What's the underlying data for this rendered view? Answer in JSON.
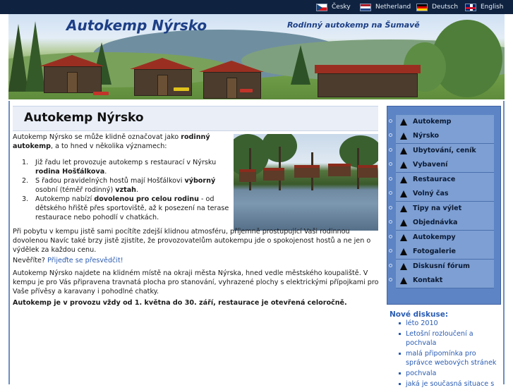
{
  "languages": [
    {
      "label": "Česky",
      "flag": "cz"
    },
    {
      "label": "Netherland",
      "flag": "nl"
    },
    {
      "label": "Deutsch",
      "flag": "de"
    },
    {
      "label": "English",
      "flag": "gb"
    }
  ],
  "banner": {
    "title": "Autokemp Nýrsko",
    "subtitle": "Rodinný autokemp na Šumavě"
  },
  "main": {
    "heading": "Autokemp Nýrsko",
    "intro_pre": "Autokemp Nýrsko se může klidně označovat jako ",
    "intro_bold": "rodinný autokemp",
    "intro_post": ", a to hned v několika významech:",
    "list": [
      {
        "num": "1.",
        "pre": "Již řadu let provozuje autokemp s restaurací v Nýrsku ",
        "bold": "rodina Hošťálkova",
        "post": "."
      },
      {
        "num": "2.",
        "pre": "S řadou pravidelných hostů mají Hošťálkovi ",
        "bold": "výborný",
        "mid": " osobní (téměř rodinný) ",
        "bold2": "vztah",
        "post": "."
      },
      {
        "num": "3.",
        "pre": "Autokemp nabízí ",
        "bold": "dovolenou pro celou rodinu",
        "post": " - od dětského hřiště přes sportoviště, až k posezení na terase restaurace nebo pohodlí v chatkách."
      }
    ],
    "para_stay": "Při pobytu v kempu jistě sami pocítíte zdejší klidnou atmosféru, příjemně prostupující Vaši rodinnou dovolenou Navíc také brzy jistě zjistíte, že provozovatelům autokempu jde o spokojenost hostů a ne jen o výdělek za každou cenu.",
    "believe_label": "Nevěříte?",
    "believe_link": "Přijeďte se přesvědčit!",
    "para_location": "Autokemp Nýrsko najdete na klidném místě na okraji města Nýrska, hned vedle městského koupaliště. V kempu je pro Vás připravena travnatá plocha pro stanování, vyhrazené plochy s elektrickými přípojkami pro Vaše přívěsy a karavany i pohodlné chatky.",
    "para_open": "Autokemp je v provozu vždy od 1. května do 30. září, restaurace je otevřená celoročně."
  },
  "sidebar": {
    "menu": [
      {
        "label": "Autokemp"
      },
      {
        "label": "Nýrsko"
      },
      {
        "label": "Ubytování, ceník"
      },
      {
        "label": "Vybavení"
      },
      {
        "label": "Restaurace"
      },
      {
        "label": "Volný čas"
      },
      {
        "label": "Tipy na výlet"
      },
      {
        "label": "Objednávka"
      },
      {
        "label": "Autokempy"
      },
      {
        "label": "Fotogalerie"
      },
      {
        "label": "Diskusní fórum"
      },
      {
        "label": "Kontakt"
      }
    ],
    "discussions_title": "Nové diskuse:",
    "discussions": [
      {
        "label": "léto 2010"
      },
      {
        "label": "Letošní rozloučení a pochvala"
      },
      {
        "label": "malá připomínka pro správce webových stránek"
      },
      {
        "label": "pochvala"
      },
      {
        "label": "jaká je současná situace s"
      }
    ]
  },
  "colors": {
    "accent": "#2a5cb3",
    "sidebar": "#5d84c4",
    "topbar": "#0f2340"
  }
}
